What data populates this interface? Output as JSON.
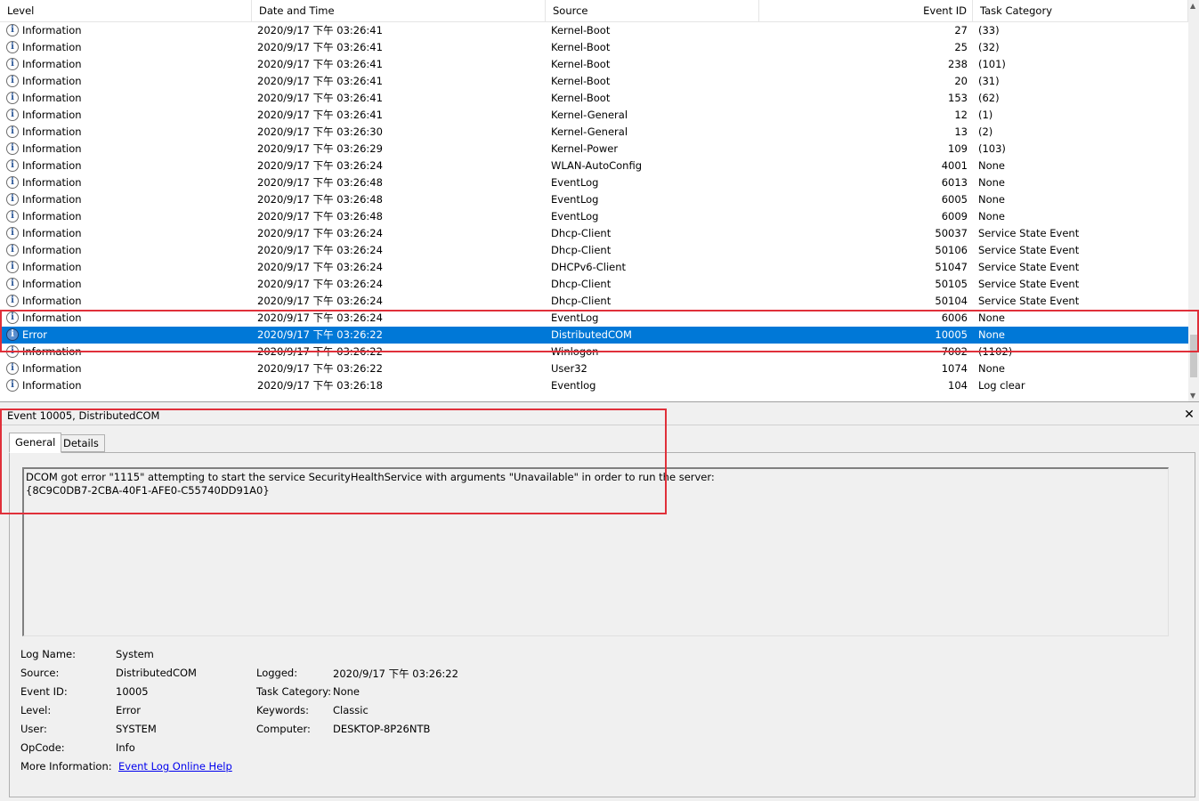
{
  "columns": {
    "level": "Level",
    "date_time": "Date and Time",
    "source": "Source",
    "event_id": "Event ID",
    "task_category": "Task Category"
  },
  "events": [
    {
      "level": "Information",
      "date": "2020/9/17 下午 03:26:41",
      "source": "Kernel-Boot",
      "id": "27",
      "task": "(33)"
    },
    {
      "level": "Information",
      "date": "2020/9/17 下午 03:26:41",
      "source": "Kernel-Boot",
      "id": "25",
      "task": "(32)"
    },
    {
      "level": "Information",
      "date": "2020/9/17 下午 03:26:41",
      "source": "Kernel-Boot",
      "id": "238",
      "task": "(101)"
    },
    {
      "level": "Information",
      "date": "2020/9/17 下午 03:26:41",
      "source": "Kernel-Boot",
      "id": "20",
      "task": "(31)"
    },
    {
      "level": "Information",
      "date": "2020/9/17 下午 03:26:41",
      "source": "Kernel-Boot",
      "id": "153",
      "task": "(62)"
    },
    {
      "level": "Information",
      "date": "2020/9/17 下午 03:26:41",
      "source": "Kernel-General",
      "id": "12",
      "task": "(1)"
    },
    {
      "level": "Information",
      "date": "2020/9/17 下午 03:26:30",
      "source": "Kernel-General",
      "id": "13",
      "task": "(2)"
    },
    {
      "level": "Information",
      "date": "2020/9/17 下午 03:26:29",
      "source": "Kernel-Power",
      "id": "109",
      "task": "(103)"
    },
    {
      "level": "Information",
      "date": "2020/9/17 下午 03:26:24",
      "source": "WLAN-AutoConfig",
      "id": "4001",
      "task": "None"
    },
    {
      "level": "Information",
      "date": "2020/9/17 下午 03:26:48",
      "source": "EventLog",
      "id": "6013",
      "task": "None"
    },
    {
      "level": "Information",
      "date": "2020/9/17 下午 03:26:48",
      "source": "EventLog",
      "id": "6005",
      "task": "None"
    },
    {
      "level": "Information",
      "date": "2020/9/17 下午 03:26:48",
      "source": "EventLog",
      "id": "6009",
      "task": "None"
    },
    {
      "level": "Information",
      "date": "2020/9/17 下午 03:26:24",
      "source": "Dhcp-Client",
      "id": "50037",
      "task": "Service State Event"
    },
    {
      "level": "Information",
      "date": "2020/9/17 下午 03:26:24",
      "source": "Dhcp-Client",
      "id": "50106",
      "task": "Service State Event"
    },
    {
      "level": "Information",
      "date": "2020/9/17 下午 03:26:24",
      "source": "DHCPv6-Client",
      "id": "51047",
      "task": "Service State Event"
    },
    {
      "level": "Information",
      "date": "2020/9/17 下午 03:26:24",
      "source": "Dhcp-Client",
      "id": "50105",
      "task": "Service State Event"
    },
    {
      "level": "Information",
      "date": "2020/9/17 下午 03:26:24",
      "source": "Dhcp-Client",
      "id": "50104",
      "task": "Service State Event"
    },
    {
      "level": "Information",
      "date": "2020/9/17 下午 03:26:24",
      "source": "EventLog",
      "id": "6006",
      "task": "None"
    },
    {
      "level": "Error",
      "date": "2020/9/17 下午 03:26:22",
      "source": "DistributedCOM",
      "id": "10005",
      "task": "None",
      "selected": true
    },
    {
      "level": "Information",
      "date": "2020/9/17 下午 03:26:22",
      "source": "Winlogon",
      "id": "7002",
      "task": "(1102)"
    },
    {
      "level": "Information",
      "date": "2020/9/17 下午 03:26:22",
      "source": "User32",
      "id": "1074",
      "task": "None"
    },
    {
      "level": "Information",
      "date": "2020/9/17 下午 03:26:18",
      "source": "Eventlog",
      "id": "104",
      "task": "Log clear"
    }
  ],
  "detail": {
    "title": "Event 10005, DistributedCOM",
    "tabs": {
      "general": "General",
      "details": "Details"
    },
    "message": "DCOM got error \"1115\" attempting to start the service SecurityHealthService with arguments \"Unavailable\" in order to run the server:\n{8C9C0DB7-2CBA-40F1-AFE0-C55740DD91A0}",
    "labels": {
      "log_name": "Log Name:",
      "source": "Source:",
      "event_id": "Event ID:",
      "level": "Level:",
      "user": "User:",
      "opcode": "OpCode:",
      "more_info": "More Information:",
      "logged": "Logged:",
      "task_category": "Task Category:",
      "keywords": "Keywords:",
      "computer": "Computer:"
    },
    "values": {
      "log_name": "System",
      "source": "DistributedCOM",
      "event_id": "10005",
      "level": "Error",
      "user": "SYSTEM",
      "opcode": "Info",
      "more_info": "Event Log Online Help",
      "logged": "2020/9/17 下午 03:26:22",
      "task_category": "None",
      "keywords": "Classic",
      "computer": "DESKTOP-8P26NTB"
    }
  },
  "colors": {
    "selection": "#0078d7",
    "callout": "#e0303a",
    "link": "#0000ee"
  }
}
